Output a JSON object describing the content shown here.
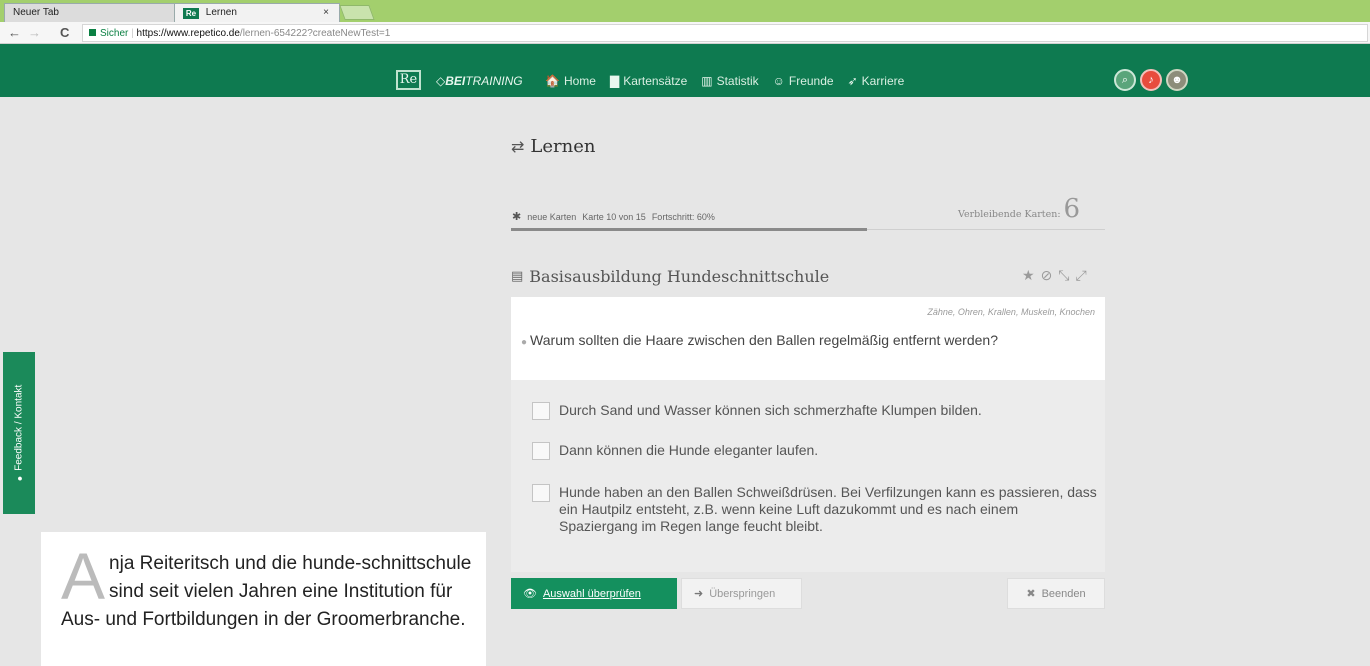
{
  "browser": {
    "tabs": [
      {
        "label": "Neuer Tab",
        "active": false
      },
      {
        "label": "Lernen",
        "active": true,
        "favicon": "Re"
      }
    ],
    "close_glyph": "×",
    "nav": {
      "back": "←",
      "forward": "→",
      "reload": "C"
    },
    "url": {
      "secure_label": "Sicher",
      "host": "https://www.repetico.de",
      "path": "/lernen-654222?createNewTest=1"
    }
  },
  "appnav": {
    "logo": "Re",
    "brand_prefix": "BEI",
    "brand_suffix": "TRAINING",
    "items": [
      {
        "icon": "home-icon",
        "glyph": "🏠",
        "label": "Home"
      },
      {
        "icon": "cards-icon",
        "glyph": "▇",
        "label": "Kartensätze"
      },
      {
        "icon": "stats-icon",
        "glyph": "▥",
        "label": "Statistik"
      },
      {
        "icon": "friends-icon",
        "glyph": "☺",
        "label": "Freunde"
      },
      {
        "icon": "career-icon",
        "glyph": "➶",
        "label": "Karriere"
      }
    ]
  },
  "learn": {
    "title": "Lernen",
    "meta": {
      "new_cards": "neue Karten",
      "card_position": "Karte 10 von 15",
      "progress_text": "Fortschritt: 60%",
      "progress": 0.6
    },
    "remaining_label": "Verbleibende Karten:",
    "remaining_count": "6",
    "card_set": "Basisausbildung Hundeschnittschule",
    "tags": "Zähne, Ohren, Krallen, Muskeln, Knochen",
    "question": "Warum sollten die Haare zwischen den Ballen regelmäßig entfernt werden?",
    "answers": [
      "Durch Sand und Wasser können sich schmerzhafte Klumpen bilden.",
      "Dann können die Hunde eleganter laufen.",
      "Hunde haben an den Ballen Schweißdrüsen. Bei Verfilzungen kann es passieren, dass ein Hautpilz entsteht, z.B. wenn keine Luft dazukommt und es nach einem Spaziergang im Regen lange feucht bleibt."
    ],
    "buttons": {
      "check": "Auswahl überprüfen",
      "skip": "Überspringen",
      "end": "Beenden"
    }
  },
  "feedback_label": "Feedback / Kontakt",
  "article": {
    "dropcap": "A",
    "text": "nja Reiteritsch und die hunde-schnittschule sind seit vielen Jahren eine Institution für Aus- und Fortbildungen in der Groomerbranche."
  }
}
